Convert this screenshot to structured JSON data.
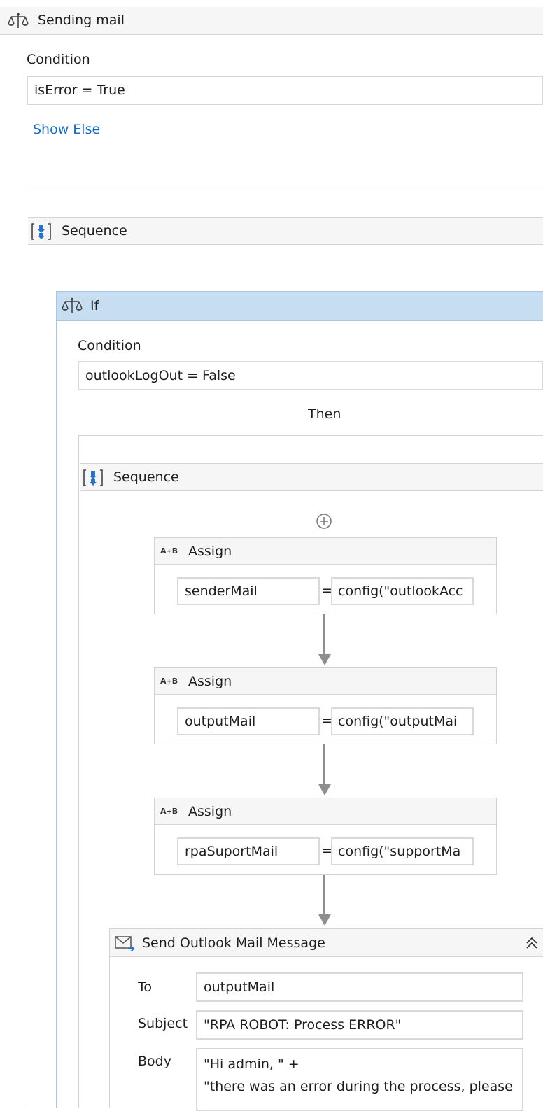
{
  "outer_if": {
    "title": "Sending mail",
    "condition_label": "Condition",
    "condition_value": "isError = True",
    "show_else": "Show Else"
  },
  "outer_sequence": {
    "title": "Sequence"
  },
  "inner_if": {
    "title": "If",
    "condition_label": "Condition",
    "condition_value": "outlookLogOut = False",
    "then_label": "Then"
  },
  "inner_sequence": {
    "title": "Sequence"
  },
  "assigns": [
    {
      "icon_text": "A+B",
      "title": "Assign",
      "to": "senderMail",
      "eq": "=",
      "value": "config(\"outlookAcc"
    },
    {
      "icon_text": "A+B",
      "title": "Assign",
      "to": "outputMail",
      "eq": "=",
      "value": "config(\"outputMai"
    },
    {
      "icon_text": "A+B",
      "title": "Assign",
      "to": "rpaSuportMail",
      "eq": "=",
      "value": "config(\"supportMa"
    }
  ],
  "send_mail": {
    "title": "Send Outlook Mail Message",
    "to_label": "To",
    "to_value": "outputMail",
    "subject_label": "Subject",
    "subject_value": "\"RPA ROBOT: Process ERROR\"",
    "body_label": "Body",
    "body_line1": "\"Hi admin, \" +",
    "body_line2": "\"there was an error during the process, please"
  },
  "colors": {
    "if_header_selected": "#c7def2",
    "link": "#1a6cbf",
    "sequence_icon": "#2b73c6"
  }
}
